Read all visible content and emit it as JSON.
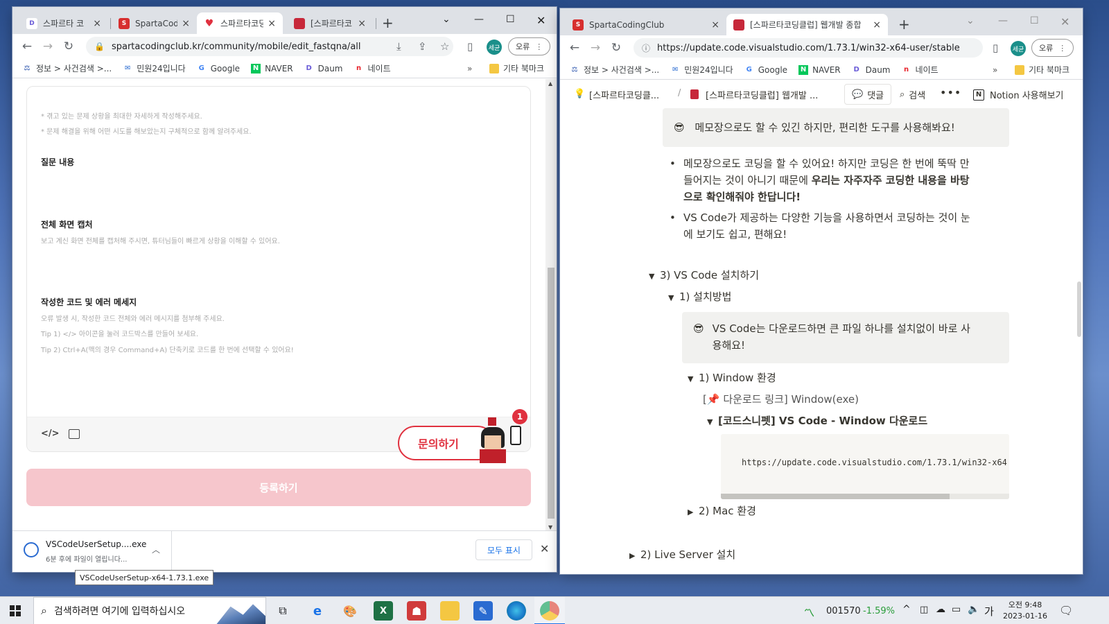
{
  "left_window": {
    "tabs": [
      {
        "title": "스파르타 코",
        "favicon": "daum-icon",
        "color": "#6a5cd8"
      },
      {
        "title": "SpartaCodin",
        "favicon": "sparta-icon",
        "color": "#d72e2e"
      },
      {
        "title": "스파르타코딩",
        "favicon": "heart-icon",
        "color": "#e0313f",
        "active": true
      },
      {
        "title": "[스파르타코",
        "favicon": "book-icon",
        "color": "#c7283a"
      }
    ],
    "url": "spartacodingclub.kr/community/mobile/edit_fastqna/all",
    "profile": "세균",
    "error_label": "오류",
    "bookmarks": [
      "정보 > 사건검색 >...",
      "민원24입니다",
      "Google",
      "NAVER",
      "Daum",
      "네이트"
    ],
    "other_bookmarks": "기타 북마크",
    "form": {
      "hint_1": "* 겪고 있는 문제 상황을 최대한 자세하게 작성해주세요.",
      "hint_2": "* 문제 해결을 위해 어떤 시도를 해보았는지 구체적으로 함께 알려주세요.",
      "question_label": "질문 내용",
      "capture_label": "전체 화면 캡처",
      "capture_hint": "보고 계신 화면 전체를 캡처해 주시면, 튜터님들이 빠르게 상황을 이해할 수 있어요.",
      "code_label": "작성한 코드 및 에러 메세지",
      "code_hint_1": "오류 발생 시, 작성한 코드 전체와 에러 메시지를 첨부해 주세요.",
      "code_hint_2": "Tip 1) </> 아이콘을 눌러 코드박스를 만들어 보세요.",
      "code_hint_3": "Tip 2) Ctrl+A(맥의 경우 Command+A) 단축키로 코드를 한 번에 선택할 수 있어요!",
      "inquiry_label": "문의하기",
      "badge_count": "1",
      "submit_label": "등록하기"
    },
    "download": {
      "filename": "VSCodeUserSetup....exe",
      "status": "6분 후에 파일이 열립니다...",
      "show_all": "모두 표시",
      "tooltip": "VSCodeUserSetup-x64-1.73.1.exe"
    }
  },
  "right_window": {
    "tabs": [
      {
        "title": "SpartaCodingClub",
        "favicon": "sparta-icon",
        "color": "#d72e2e"
      },
      {
        "title": "[스파르타코딩클럽] 웹개발 종합",
        "favicon": "book-icon",
        "color": "#c7283a",
        "active": true
      }
    ],
    "url": "https://update.code.visualstudio.com/1.73.1/win32-x64-user/stable",
    "profile": "세균",
    "error_label": "오류",
    "bookmarks": [
      "정보 > 사건검색 >...",
      "민원24입니다",
      "Google",
      "NAVER",
      "Daum",
      "네이트"
    ],
    "other_bookmarks": "기타 북마크",
    "notion": {
      "breadcrumb_1": "[스파르타코딩클...",
      "breadcrumb_sep": "/",
      "breadcrumb_2": "[스파르타코딩클럽] 웹개발 ...",
      "comment": "댓글",
      "search": "검색",
      "try_notion": "Notion 사용해보기",
      "callout_1": "메모장으로도 할 수 있긴 하지만, 편리한 도구를 사용해봐요!",
      "bullet_1_a": "메모장으로도 코딩을 할 수 있어요! 하지만 코딩은 한 번에 뚝딱 만",
      "bullet_1_b": "들어지는 것이 아니기 때문에 ",
      "bullet_1_b_bold": "우리는 자주자주 코딩한 내용을 바탕",
      "bullet_1_c_bold": "으로 확인해줘야 한답니다!",
      "bullet_2_a": " VS Code가 제공하는 다양한 기능을 사용하면서 코딩하는 것이 눈",
      "bullet_2_b": "에 보기도 쉽고, 편해요!",
      "toggle_3": "3) VS Code 설치하기",
      "toggle_3_1": "1) 설치방법",
      "callout_2_a": "VS Code는 다운로드하면 큰 파일 하나를 설치없이 바로 사",
      "callout_2_b": "용해요!",
      "toggle_win": "1) Window 환경",
      "download_link": "다운로드 링크] Window(exe)",
      "link_prefix": "[",
      "snippet_toggle": "[코드스니펫] VS Code - Window 다운로드",
      "code": "https://update.code.visualstudio.com/1.73.1/win32-x64",
      "toggle_mac": "2) Mac 환경",
      "toggle_live": "2) Live Server 설치"
    }
  },
  "taskbar": {
    "search_placeholder": "검색하려면 여기에 입력하십시오",
    "stock_value": "001570",
    "stock_change": "-1.59%",
    "ime": "가",
    "time": "오전 9:48",
    "date": "2023-01-16"
  }
}
